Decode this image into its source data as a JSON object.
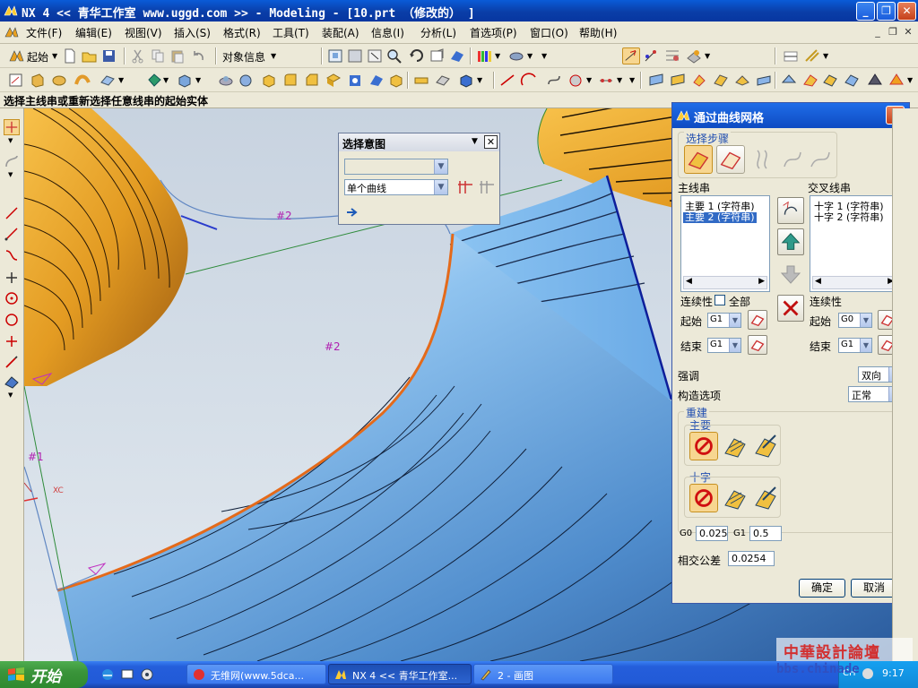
{
  "window": {
    "title": "NX 4 << 青华工作室 www.uggd.com >> - Modeling - [10.prt （修改的） ]",
    "minimize_icon": "minimize-icon",
    "restore_icon": "restore-icon",
    "close_icon": "close-icon"
  },
  "menu": {
    "items": [
      {
        "label": "文件(F)"
      },
      {
        "label": "编辑(E)"
      },
      {
        "label": "视图(V)"
      },
      {
        "label": "插入(S)"
      },
      {
        "label": "格式(R)"
      },
      {
        "label": "工具(T)"
      },
      {
        "label": "装配(A)"
      },
      {
        "label": "信息(I)"
      },
      {
        "label": "分析(L)"
      },
      {
        "label": "首选项(P)"
      },
      {
        "label": "窗口(O)"
      },
      {
        "label": "帮助(H)"
      }
    ]
  },
  "toolbar": {
    "start_label": "起始",
    "object_info_label": "对象信息"
  },
  "prompt": {
    "text": "选择主线串或重新选择任意线串的起始实体"
  },
  "viewport": {
    "labels": [
      "#2",
      "#2",
      "#1",
      "XC"
    ]
  },
  "selection_dialog": {
    "title": "选择意图",
    "filter_value": "",
    "curve_rule": "单个曲线"
  },
  "mesh_dialog": {
    "title": "通过曲线网格",
    "steps_label": "选择步骤",
    "primary_label": "主线串",
    "cross_label": "交叉线串",
    "primary_items": [
      "主要 1 (字符串)",
      "主要 2 (字符串)"
    ],
    "cross_items": [
      "十字 1 (字符串)",
      "十字 2 (字符串)"
    ],
    "continuity_label": "连续性",
    "all_label": "全部",
    "start_label": "起始",
    "end_label": "结束",
    "primary_start": "G1",
    "primary_end": "G1",
    "cross_start": "G0",
    "cross_end": "G1",
    "emphasis_label": "强调",
    "emphasis_value": "双向",
    "construction_label": "构造选项",
    "construction_value": "正常",
    "rebuild_label": "重建",
    "rebuild_primary_label": "主要",
    "rebuild_cross_label": "十字",
    "g0_label": "G0",
    "g0_value": "0.025",
    "g1_label": "G1",
    "g1_value": "0.5",
    "tolerance_label": "相交公差",
    "tolerance_value": "0.0254",
    "ok_label": "确定",
    "cancel_label": "取消"
  },
  "taskbar": {
    "start_label": "开始",
    "tasks": [
      {
        "label": "无维网(www.5dca..."
      },
      {
        "label": "NX 4 << 青华工作室..."
      },
      {
        "label": "2 - 画图"
      }
    ],
    "clock": "9:17",
    "ime": "CH"
  },
  "watermark": {
    "text": "中華設計論壇",
    "url": "bbs.chinade"
  }
}
